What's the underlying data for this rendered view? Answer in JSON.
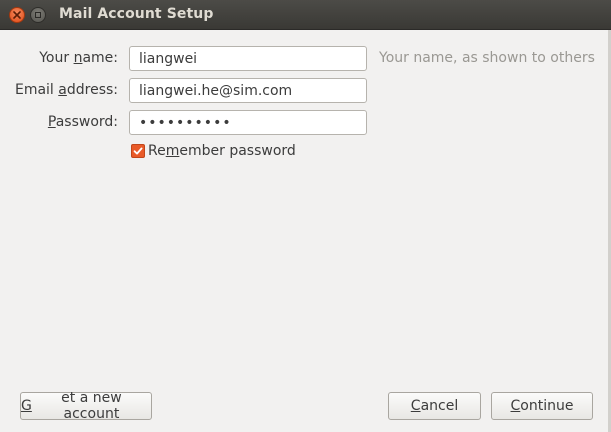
{
  "window": {
    "title": "Mail Account Setup"
  },
  "form": {
    "name": {
      "label_pre": "Your ",
      "label_u": "n",
      "label_post": "ame:",
      "value": "liangwei",
      "hint": "Your name, as shown to others"
    },
    "email": {
      "label_pre": "Email ",
      "label_u": "a",
      "label_post": "ddress:",
      "value": "liangwei.he@sim.com"
    },
    "password": {
      "label_pre": "",
      "label_u": "P",
      "label_post": "assword:",
      "value": "••••••••••"
    },
    "remember": {
      "label_pre": "Re",
      "label_u": "m",
      "label_post": "ember password",
      "checked": true
    }
  },
  "buttons": {
    "new_account": {
      "pre": "",
      "u": "G",
      "post": "et a new account"
    },
    "cancel": {
      "pre": "",
      "u": "C",
      "post": "ancel"
    },
    "continue": {
      "pre": "",
      "u": "C",
      "post": "ontinue"
    }
  },
  "colors": {
    "accent": "#e95a28",
    "titlebar": "#3c3b37",
    "background": "#f2f1f0"
  }
}
